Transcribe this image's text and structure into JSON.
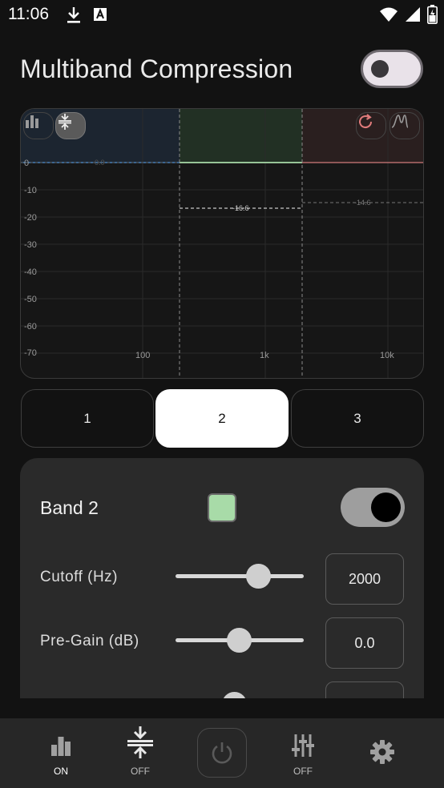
{
  "status_bar": {
    "time": "11:06"
  },
  "header": {
    "title": "Multiband Compression"
  },
  "graph": {
    "y_ticks": [
      "0",
      "-10",
      "-20",
      "-30",
      "-40",
      "-50",
      "-60",
      "-70"
    ],
    "x_ticks": [
      "100",
      "1k",
      "10k"
    ],
    "band_labels": [
      "0.0",
      "-16.6",
      "-14.6"
    ],
    "colors": {
      "band1": "#4f8fd0",
      "band2": "#a8dba8",
      "band3": "#d07b7b"
    }
  },
  "tabs": [
    {
      "label": "1"
    },
    {
      "label": "2"
    },
    {
      "label": "3"
    }
  ],
  "band": {
    "title": "Band 2",
    "swatch_color": "#a8dba8",
    "params": [
      {
        "label": "Cutoff (Hz)",
        "value": "2000",
        "fraction": 0.65
      },
      {
        "label": "Pre-Gain (dB)",
        "value": "0.0",
        "fraction": 0.5
      }
    ]
  },
  "bottom_nav": {
    "eq_label": "ON",
    "compressor_label": "OFF",
    "filters_label": "OFF"
  }
}
